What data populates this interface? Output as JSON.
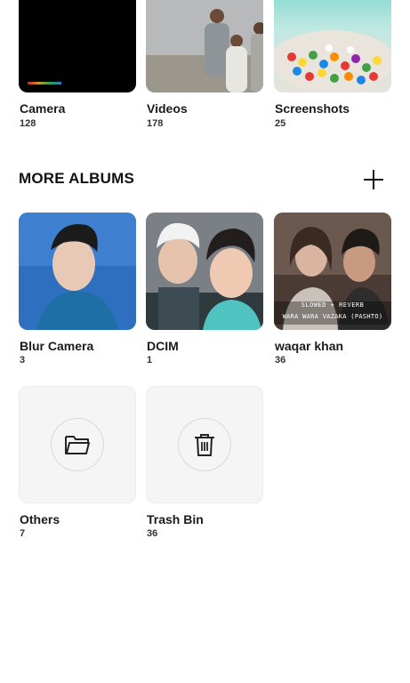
{
  "top_albums": [
    {
      "name": "Camera",
      "count": "128",
      "icon": "camera-thumbnail"
    },
    {
      "name": "Videos",
      "count": "178",
      "icon": "videos-thumbnail"
    },
    {
      "name": "Screenshots",
      "count": "25",
      "icon": "screenshots-thumbnail"
    }
  ],
  "more_albums": {
    "title": "MORE ALBUMS",
    "add_icon": "plus-icon",
    "albums": [
      {
        "name": "Blur Camera",
        "count": "3"
      },
      {
        "name": "DCIM",
        "count": "1"
      },
      {
        "name": "waqar khan",
        "count": "36",
        "overlay_line1": "SLOWED + REVERB",
        "overlay_line2": "WARA WARA VAZAKA (PASHTO)"
      }
    ],
    "system_albums": [
      {
        "name": "Others",
        "count": "7",
        "icon": "folder-icon"
      },
      {
        "name": "Trash Bin",
        "count": "36",
        "icon": "trash-icon"
      }
    ]
  },
  "colors": {
    "accent": "#111111",
    "placeholder_bg": "#f5f5f5"
  }
}
